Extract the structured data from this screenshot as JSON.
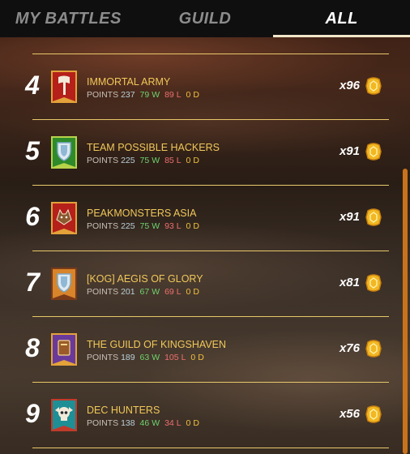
{
  "tabs": [
    {
      "label": "MY BATTLES",
      "active": false
    },
    {
      "label": "GUILD",
      "active": false
    },
    {
      "label": "ALL",
      "active": true
    }
  ],
  "labels": {
    "points": "POINTS",
    "w": "W",
    "l": "L",
    "d": "D"
  },
  "rows": [
    {
      "rank": "4",
      "name": "IMMORTAL ARMY",
      "points": "237",
      "wins": "79",
      "losses": "89",
      "draws": "0",
      "count": "x96",
      "emblem": "axe-icon",
      "banner_color": "#b5201a"
    },
    {
      "rank": "5",
      "name": "TEAM POSSIBLE HACKERS",
      "points": "225",
      "wins": "75",
      "losses": "85",
      "draws": "0",
      "count": "x91",
      "emblem": "shield-icon",
      "banner_color": "#2e8a2a"
    },
    {
      "rank": "6",
      "name": "PEAKMONSTERS ASIA",
      "points": "225",
      "wins": "75",
      "losses": "93",
      "draws": "0",
      "count": "x91",
      "emblem": "wolf-icon",
      "banner_color": "#b5201a"
    },
    {
      "rank": "7",
      "name": "[KOG] AEGIS OF GLORY",
      "points": "201",
      "wins": "67",
      "losses": "69",
      "draws": "0",
      "count": "x81",
      "emblem": "shield-icon",
      "banner_color": "#d8842a"
    },
    {
      "rank": "8",
      "name": "THE GUILD OF KINGSHAVEN",
      "points": "189",
      "wins": "63",
      "losses": "105",
      "draws": "0",
      "count": "x76",
      "emblem": "book-icon",
      "banner_color": "#6a3a9a"
    },
    {
      "rank": "9",
      "name": "DEC HUNTERS",
      "points": "138",
      "wins": "46",
      "losses": "34",
      "draws": "0",
      "count": "x56",
      "emblem": "skull-icon",
      "banner_color": "#1f8f96"
    }
  ],
  "reward_icon": "merit-coin-icon",
  "colors": {
    "accent_gold": "#f0c85a",
    "win": "#6fd36f",
    "loss": "#ef6f6f",
    "draw": "#f0c040",
    "scrollbar": "#c8731c"
  }
}
